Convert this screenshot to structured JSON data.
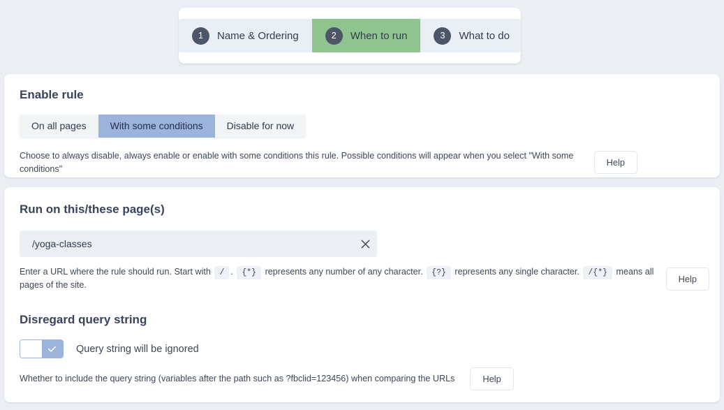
{
  "stepper": {
    "steps": [
      {
        "num": "1",
        "label": "Name & Ordering",
        "active": false
      },
      {
        "num": "2",
        "label": "When to run",
        "active": true
      },
      {
        "num": "3",
        "label": "What to do",
        "active": false
      }
    ],
    "active_color": "#8fc48f",
    "badge_color": "#4d5668"
  },
  "enable_rule": {
    "title": "Enable rule",
    "options": [
      {
        "label": "On all pages",
        "selected": false
      },
      {
        "label": "With some conditions",
        "selected": true
      },
      {
        "label": "Disable for now",
        "selected": false
      }
    ],
    "selected_color": "#9cb4dc",
    "help_text": "Choose to always disable, always enable or enable with some conditions this rule. Possible conditions will appear when you select \"With some conditions\"",
    "help_button": "Help"
  },
  "run_on_pages": {
    "title": "Run on this/these page(s)",
    "input_value": "/yoga-classes",
    "input_placeholder": "/yoga-classes",
    "clear_icon": "close-icon",
    "help_parts": {
      "p1": "Enter a URL where the rule should run. Start with",
      "code1": "/",
      "p2": ".",
      "code2": "{*}",
      "p3": "represents any number of any character.",
      "code3": "{?}",
      "p4": "represents any single character.",
      "code4": "/{*}",
      "p5": "means all pages of the site."
    },
    "help_button": "Help"
  },
  "query_string": {
    "title": "Disregard query string",
    "toggle_state": "on",
    "toggle_icon": "check-icon",
    "toggle_label": "Query string will be ignored",
    "help_text": "Whether to include the query string (variables after the path such as ?fbclid=123456) when comparing the URLs",
    "help_button": "Help"
  }
}
